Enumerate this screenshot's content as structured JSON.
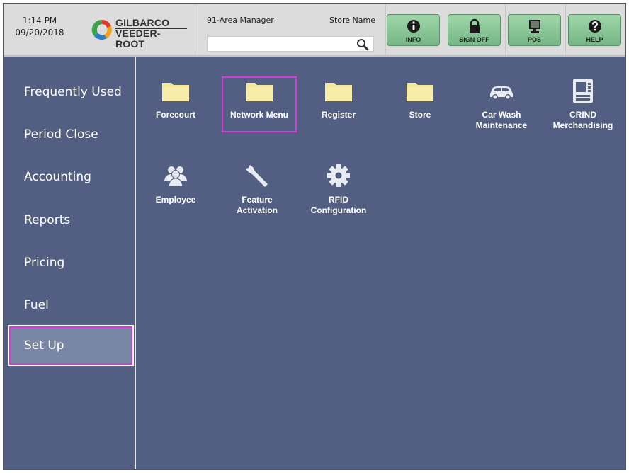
{
  "header": {
    "time": "1:14 PM",
    "date": "09/20/2018",
    "logo_line1": "GILBARCO",
    "logo_line2": "VEEDER-ROOT",
    "user": "91-Area Manager",
    "store_name": "Store Name",
    "search_value": "",
    "buttons": [
      {
        "label": "INFO",
        "icon": "info-icon"
      },
      {
        "label": "SIGN OFF",
        "icon": "lock-icon"
      },
      {
        "label": "POS",
        "icon": "monitor-icon"
      },
      {
        "label": "HELP",
        "icon": "question-icon"
      }
    ]
  },
  "sidebar": {
    "items": [
      {
        "label": "Frequently Used"
      },
      {
        "label": "Period Close"
      },
      {
        "label": "Accounting"
      },
      {
        "label": "Reports"
      },
      {
        "label": "Pricing"
      },
      {
        "label": "Fuel"
      },
      {
        "label": "Set Up",
        "selected": true
      }
    ]
  },
  "main": {
    "tiles": [
      {
        "line1": "Forecourt",
        "line2": "",
        "icon": "folder-icon"
      },
      {
        "line1": "Network Menu",
        "line2": "",
        "icon": "folder-icon",
        "highlighted": true
      },
      {
        "line1": "Register",
        "line2": "",
        "icon": "folder-icon"
      },
      {
        "line1": "Store",
        "line2": "",
        "icon": "folder-icon"
      },
      {
        "line1": "Car Wash",
        "line2": "Maintenance",
        "icon": "car-icon"
      },
      {
        "line1": "CRIND",
        "line2": "Merchandising",
        "icon": "crind-icon"
      },
      {
        "line1": "Employee",
        "line2": "",
        "icon": "people-icon"
      },
      {
        "line1": "Feature",
        "line2": "Activation",
        "icon": "wrench-icon"
      },
      {
        "line1": "RFID",
        "line2": "Configuration",
        "icon": "gear-icon"
      }
    ]
  },
  "colors": {
    "background": "#525f82",
    "header": "#dcdcdc",
    "button_green": "#8dc99a",
    "folder_yellow": "#f3e79b",
    "highlight": "#d63cd6"
  }
}
